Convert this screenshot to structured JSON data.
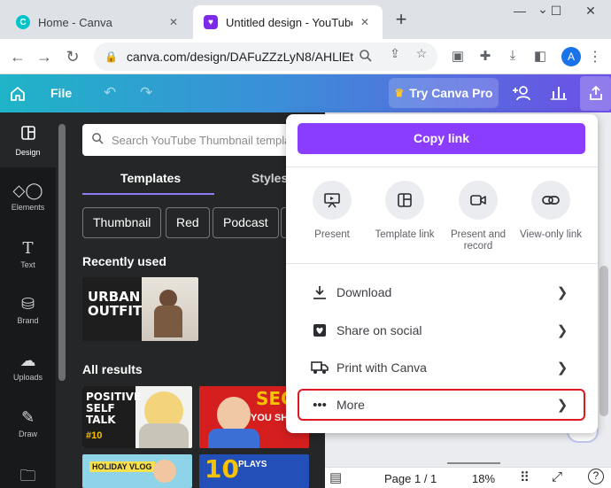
{
  "browser": {
    "tabs": [
      {
        "title": "Home - Canva",
        "active": false
      },
      {
        "title": "Untitled design - YouTube Th",
        "active": true
      }
    ],
    "new_tab_label": "+",
    "url": "canva.com/design/DAFuZZzLyN8/AHLlEt...",
    "profile_initial": "A"
  },
  "header": {
    "file_label": "File",
    "pro_label": "Try Canva Pro"
  },
  "rail": {
    "items": [
      {
        "label": "Design",
        "icon": "layout-icon"
      },
      {
        "label": "Elements",
        "icon": "shapes-icon"
      },
      {
        "label": "Text",
        "icon": "text-icon"
      },
      {
        "label": "Brand",
        "icon": "brand-icon"
      },
      {
        "label": "Uploads",
        "icon": "upload-icon"
      },
      {
        "label": "Draw",
        "icon": "draw-icon"
      },
      {
        "label": "",
        "icon": "folder-icon"
      }
    ]
  },
  "panel": {
    "search_placeholder": "Search YouTube Thumbnail templates",
    "tabs": [
      "Templates",
      "Styles"
    ],
    "chips": [
      "Thumbnail",
      "Red",
      "Podcast"
    ],
    "recently_used": "Recently used",
    "all_results": "All results",
    "thumbs": {
      "urban_outfit": "URBAN OUTFIT",
      "positive_self_talk": "POSITIVE SELF TALK",
      "episode": "#10",
      "secret": "SECRE",
      "you_should": "YOU SHO",
      "holiday_vlog": "HOLIDAY VLOG",
      "plays": "PLAYS",
      "ten": "10"
    }
  },
  "share": {
    "copy_link": "Copy link",
    "options": [
      {
        "label": "Present",
        "icon": "present-icon"
      },
      {
        "label": "Template link",
        "icon": "template-icon"
      },
      {
        "label": "Present and record",
        "icon": "record-icon"
      },
      {
        "label": "View-only link",
        "icon": "link-icon"
      }
    ],
    "rows": [
      {
        "label": "Download",
        "icon": "download-icon"
      },
      {
        "label": "Share on social",
        "icon": "heart-icon"
      },
      {
        "label": "Print with Canva",
        "icon": "truck-icon"
      },
      {
        "label": "More",
        "icon": "more-icon"
      }
    ]
  },
  "status": {
    "page": "Page 1 / 1",
    "zoom": "18%",
    "help": "?"
  },
  "colors": {
    "accent": "#8b3dff",
    "highlight": "#e0181f"
  }
}
